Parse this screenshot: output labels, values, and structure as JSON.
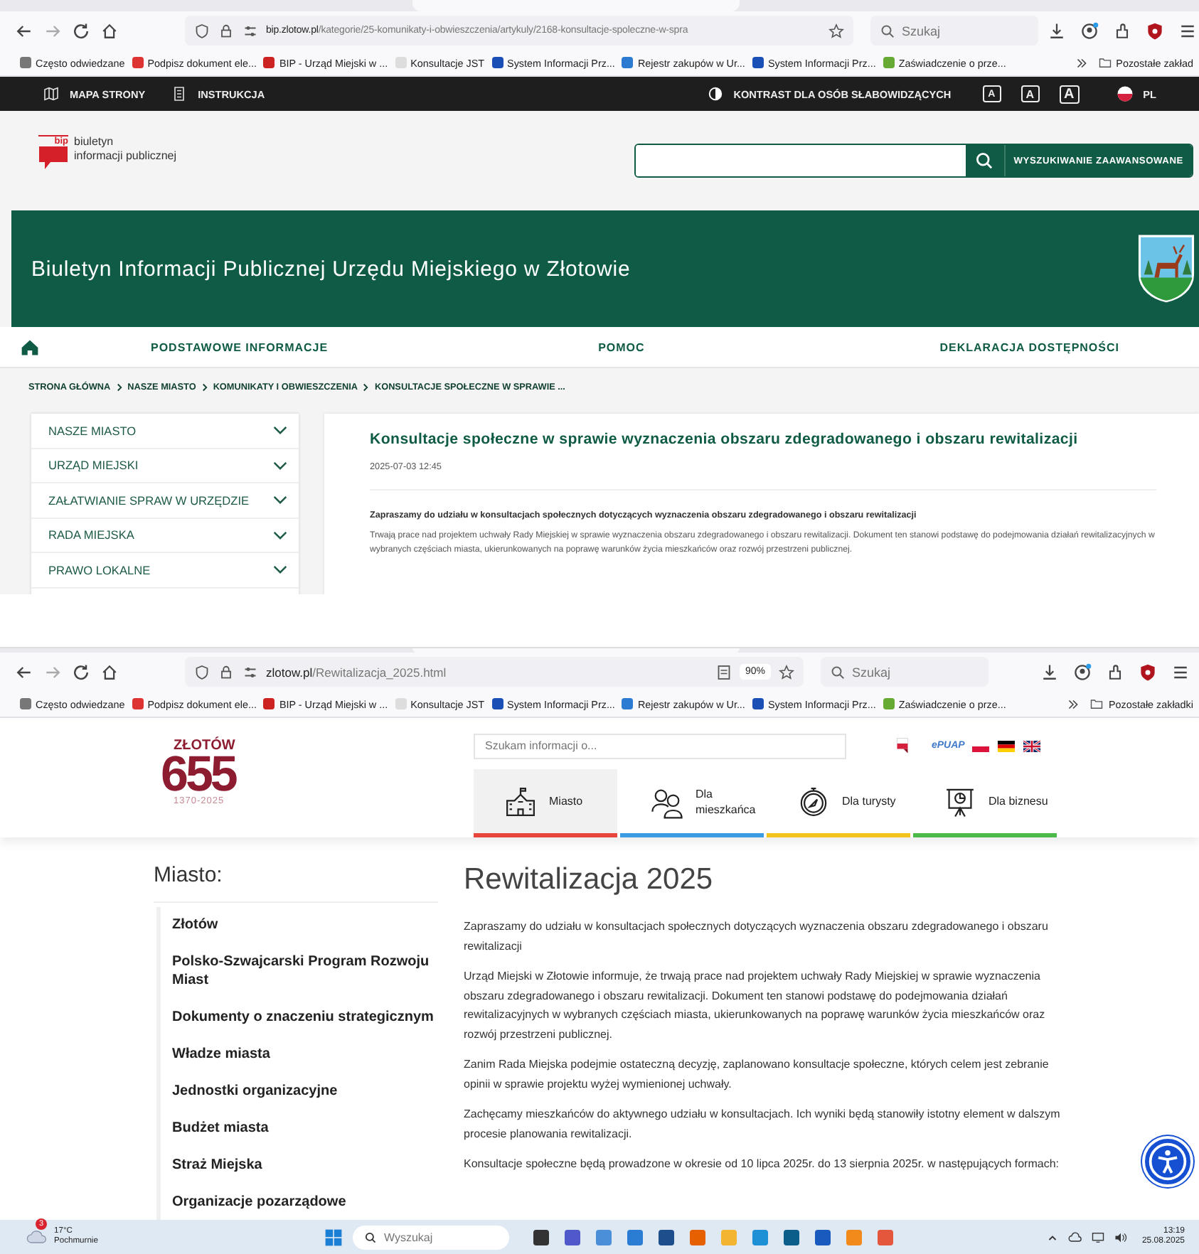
{
  "windows": [
    {
      "kind": "bip",
      "browser": {
        "url_host": "bip.zlotow.pl",
        "url_path": "/kategorie/25-komunikaty-i-obwieszczenia/artykuly/2168-konsultacje-spoleczne-w-spra",
        "search_placeholder": "Szukaj",
        "bookmarks": [
          "Często odwiedzane",
          "Podpisz dokument ele...",
          "BIP - Urząd Miejski w ...",
          "Konsultacje JST",
          "System Informacji Prz...",
          "Rejestr zakupów w Ur...",
          "System Informacji Prz...",
          "Zaświadczenie o prze..."
        ],
        "other_bookmarks": "Pozostałe zakład"
      },
      "page": {
        "topbar": {
          "links": [
            "MAPA STRONY",
            "INSTRUKCJA"
          ],
          "contrast": "KONTRAST DLA OSÓB SŁABOWIDZĄCYCH",
          "font_sizes": [
            "A",
            "A",
            "A"
          ],
          "language": "PL"
        },
        "logo": {
          "mark": "bip",
          "lines": [
            "biuletyn",
            "informacji publicznej"
          ]
        },
        "search": {
          "advanced": "WYSZUKIWANIE ZAAWANSOWANE"
        },
        "banner_title": "Biuletyn Informacji Publicznej Urzędu Miejskiego w Złotowie",
        "nav": [
          "PODSTAWOWE INFORMACJE",
          "POMOC",
          "DEKLARACJA DOSTĘPNOŚCI"
        ],
        "breadcrumb": [
          "STRONA GŁÓWNA",
          "NASZE MIASTO",
          "KOMUNIKATY I OBWIESZCZENIA",
          "KONSULTACJE SPOŁECZNE W SPRAWIE ..."
        ],
        "sidebar": [
          {
            "label": "NASZE MIASTO",
            "expanded": false
          },
          {
            "label": "URZĄD MIEJSKI",
            "expanded": false
          },
          {
            "label": "ZAŁATWIANIE SPRAW W URZĘDZIE",
            "expanded": false
          },
          {
            "label": "RADA MIEJSKA",
            "expanded": false
          },
          {
            "label": "PRAWO LOKALNE",
            "expanded": false
          }
        ],
        "article": {
          "title": "Konsultacje społeczne w sprawie wyznaczenia obszaru zdegradowanego i obszaru rewitalizacji",
          "date": "2025-07-03 12:45",
          "lead": "Zapraszamy do udziału w konsultacjach społecznych dotyczących wyznaczenia obszaru zdegradowanego i obszaru rewitalizacji",
          "body": "Trwają prace nad projektem uchwały Rady Miejskiej w sprawie wyznaczenia obszaru zdegradowanego i obszaru rewitalizacji. Dokument ten stanowi podstawę do podejmowania działań rewitalizacyjnych w wybranych częściach miasta, ukierunkowanych na poprawę warunków życia mieszkańców oraz rozwój przestrzeni publicznej."
        }
      }
    },
    {
      "kind": "city",
      "browser": {
        "url_host": "zlotow.pl",
        "url_path": "/Rewitalizacja_2025.html",
        "zoom": "90%",
        "search_placeholder": "Szukaj",
        "bookmarks": [
          "Często odwiedzane",
          "Podpisz dokument ele...",
          "BIP - Urząd Miejski w ...",
          "Konsultacje JST",
          "System Informacji Prz...",
          "Rejestr zakupów w Ur...",
          "System Informacji Prz...",
          "Zaświadczenie o prze..."
        ],
        "other_bookmarks": "Pozostałe zakładki"
      },
      "page": {
        "logo": {
          "name": "ZŁOTÓW",
          "number": "655",
          "years": "1370-2025"
        },
        "search_placeholder": "Szukam informacji o...",
        "epuap": "ePUAP",
        "tabs": [
          {
            "label": "Miasto",
            "kind": "school",
            "selected": true,
            "color": "#e8453c"
          },
          {
            "label": "Dla mieszkańca",
            "kind": "people",
            "selected": false,
            "color": "#3b9be0"
          },
          {
            "label": "Dla turysty",
            "kind": "compass",
            "selected": false,
            "color": "#f2c31b"
          },
          {
            "label": "Dla biznesu",
            "kind": "board",
            "selected": false,
            "color": "#4cba48"
          }
        ],
        "sidebar_title": "Miasto:",
        "sidebar": [
          "Złotów",
          "Polsko-Szwajcarski Program Rozwoju Miast",
          "Dokumenty o znaczeniu strategicznym",
          "Władze miasta",
          "Jednostki organizacyjne",
          "Budżet miasta",
          "Straż Miejska",
          "Organizacje pozarządowe"
        ],
        "title": "Rewitalizacja 2025",
        "paragraphs": [
          "Zapraszamy do udziału w konsultacjach społecznych dotyczących wyznaczenia obszaru zdegradowanego i obszaru rewitalizacji",
          "Urząd Miejski w Złotowie informuje, że trwają prace nad projektem uchwały Rady Miejskiej w sprawie wyznaczenia obszaru zdegradowanego i obszaru rewitalizacji. Dokument ten stanowi podstawę do podejmowania działań rewitalizacyjnych w wybranych częściach miasta, ukierunkowanych na poprawę warunków życia mieszkańców oraz rozwój przestrzeni publicznej.",
          "Zanim Rada Miejska podejmie ostateczną decyzję, zaplanowano konsultacje społeczne, których celem jest zebranie opinii w sprawie projektu wyżej wymienionej uchwały.",
          "Zachęcamy mieszkańców do aktywnego udziału w konsultacjach. Ich wyniki będą stanowiły istotny element w dalszym procesie planowania rewitalizacji.",
          "Konsultacje społeczne będą prowadzone w okresie od 10 lipca 2025r. do 13 sierpnia 2025r. w następujących formach:"
        ]
      }
    }
  ],
  "taskbar": {
    "weather_badge": "3",
    "temperature": "17°C",
    "weather": "Pochmurnie",
    "search_placeholder": "Wyszukaj",
    "time": "13:19",
    "date": "25.08.2025"
  }
}
